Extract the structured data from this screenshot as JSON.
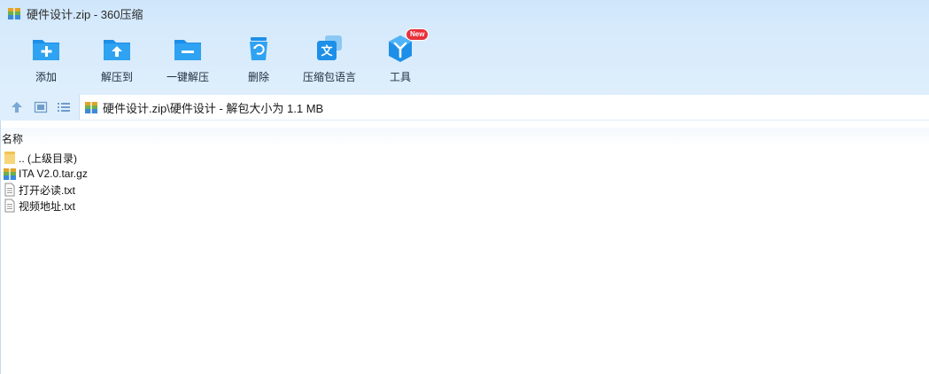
{
  "window": {
    "title": "硬件设计.zip - 360压缩"
  },
  "toolbar": {
    "items": [
      {
        "label": "添加",
        "icon": "add-folder-icon"
      },
      {
        "label": "解压到",
        "icon": "extract-to-icon"
      },
      {
        "label": "一键解压",
        "icon": "one-click-extract-icon"
      },
      {
        "label": "删除",
        "icon": "delete-icon"
      },
      {
        "label": "压缩包语言",
        "icon": "language-icon"
      },
      {
        "label": "工具",
        "icon": "tools-icon",
        "badge": "New"
      }
    ]
  },
  "nav": {
    "up_icon": "up-arrow-icon",
    "thumbnail_icon": "thumbnail-view-icon",
    "list_icon": "list-view-icon",
    "address": "硬件设计.zip\\硬件设计 - 解包大小为 1.1 MB"
  },
  "list": {
    "column_name": "名称",
    "rows": [
      {
        "name": ".. (上级目录)",
        "icon": "folder-icon"
      },
      {
        "name": "ITA V2.0.tar.gz",
        "icon": "archive-icon"
      },
      {
        "name": "打开必读.txt",
        "icon": "text-file-icon"
      },
      {
        "name": "视频地址.txt",
        "icon": "text-file-icon"
      }
    ]
  },
  "colors": {
    "accent": "#1d8fe8",
    "toolbar_bg": "#d6eafc",
    "badge": "#e8303a"
  }
}
